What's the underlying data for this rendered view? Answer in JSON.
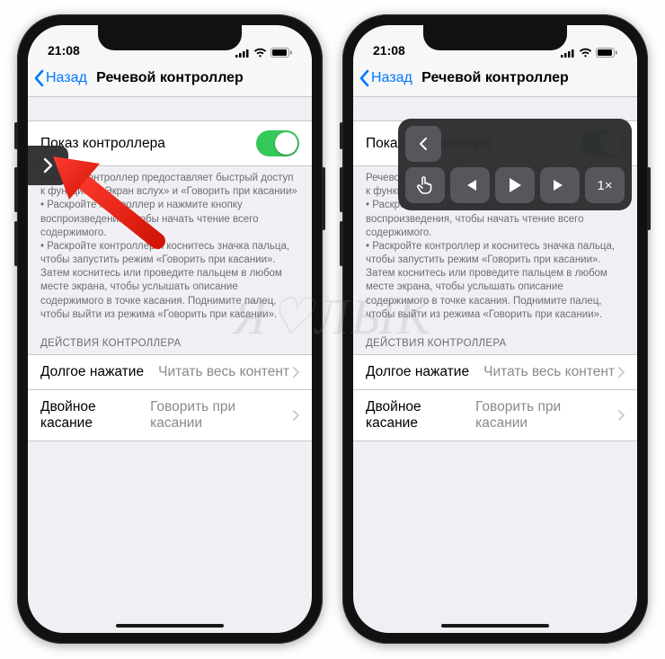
{
  "status": {
    "time": "21:08"
  },
  "nav": {
    "back": "Назад",
    "title": "Речевой контроллер"
  },
  "toggle_row": {
    "label": "Показ контроллера"
  },
  "footer": {
    "p1a": "Речевой контроллер предоставляет быстрый доступ к функциям «Экран вслух» и «Говорить при касании»",
    "p1b": " • Раскройте контроллер и нажмите кнопку воспроизведения, чтобы начать чтение всего содержимого.",
    "p1c": " • Раскройте контроллер и коснитесь значка пальца, чтобы запустить режим «Говорить при касании». Затем коснитесь или проведите пальцем в любом месте экрана, чтобы услышать описание содержимого в точке касания. Поднимите палец, чтобы выйти из режима «Говорить при касании»."
  },
  "section": {
    "header": "ДЕЙСТВИЯ КОНТРОЛЛЕРА"
  },
  "rows": [
    {
      "label": "Долгое нажатие",
      "value": "Читать весь контент"
    },
    {
      "label": "Двойное касание",
      "value": "Говорить при касании"
    }
  ],
  "panel": {
    "rate": "1×"
  },
  "watermark": "Я♡ЛЫК"
}
